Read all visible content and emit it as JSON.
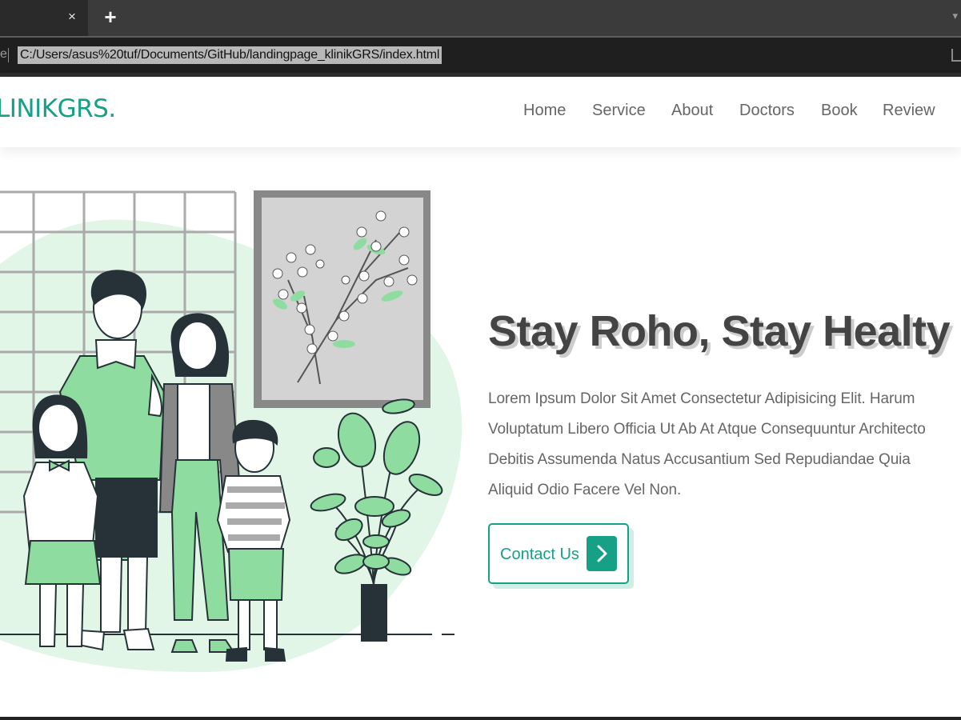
{
  "browser": {
    "tab_close": "×",
    "new_tab": "+",
    "url_prefix": "e",
    "url": "C:/Users/asus%20tuf/Documents/GitHub/landingpage_klinikGRS/index.html"
  },
  "header": {
    "logo": "LINIKGRS.",
    "nav": [
      "Home",
      "Service",
      "About",
      "Doctors",
      "Book",
      "Review"
    ]
  },
  "hero": {
    "headline": "Stay Roho, Stay Healty",
    "description_lines": [
      "Lorem Ipsum Dolor Sit Amet Consectetur Adipisicing Elit. Harum",
      "Voluptatum Libero Officia Ut Ab At Atque Consequuntur Architecto",
      "Debitis Assumenda Natus Accusantium Sed Repudiandae Quia",
      "Aliquid Odio Facere Vel Non."
    ],
    "cta_label": "Contact Us"
  },
  "colors": {
    "brand": "#16a085",
    "text": "#444444",
    "muted": "#666666",
    "illustration_green": "#8fdca0",
    "illustration_bg": "#e2f6e7",
    "dark": "#263238"
  },
  "icons": {
    "cta": "chevron-right-icon"
  }
}
